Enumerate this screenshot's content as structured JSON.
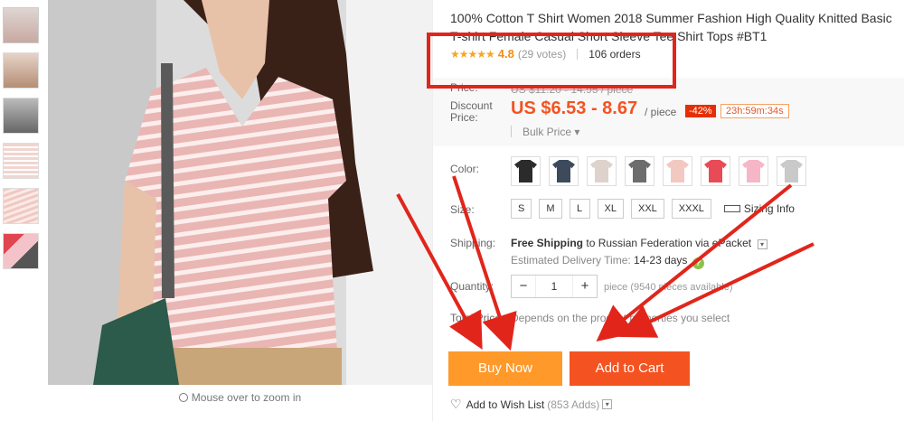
{
  "product": {
    "title_line1": "100% Cotton T Shirt Women 2018 Summer Fashion High Quality Knitted Basic",
    "title_line2": "T-shirt Female Casual Short Sleeve Tee Shirt Tops #BT1",
    "rating_value": "4.8",
    "votes": "(29 votes)",
    "orders": "106 orders",
    "stars": "★★★★★"
  },
  "gallery": {
    "zoom_hint": "Mouse over to zoom in"
  },
  "price": {
    "price_label": "Price:",
    "old_price": "US $11.20 - 14.95 / piece",
    "discount_label_1": "Discount",
    "discount_label_2": "Price:",
    "discount_price": "US $6.53 - 8.67",
    "per_piece": "/ piece",
    "discount_pct": "-42%",
    "timer": "23h:59m:34s",
    "bulk_price": "Bulk Price ▾"
  },
  "options": {
    "color_label": "Color:",
    "size_label": "Size:",
    "sizes": [
      "S",
      "M",
      "L",
      "XL",
      "XXL",
      "XXXL"
    ],
    "sizing_info": "Sizing Info",
    "colors": [
      "#2b2b2b",
      "#3c4a5c",
      "#ddd2cc",
      "#6d6d6d",
      "#f2c9c0",
      "#e84b55",
      "#f6b6c8",
      "#c9c9c9"
    ]
  },
  "shipping": {
    "label": "Shipping:",
    "free": "Free Shipping",
    "to": "to",
    "country": "Russian Federation via ePacket",
    "est_label": "Estimated Delivery Time:",
    "est_days": "14-23 days",
    "help": "?"
  },
  "quantity": {
    "label": "Quantity:",
    "value": "1",
    "minus": "−",
    "plus": "+",
    "note": "piece (9540 pieces available)"
  },
  "total": {
    "label": "Total Price:",
    "note": "Depends on the product properties you select"
  },
  "actions": {
    "buy_now": "Buy Now",
    "add_to_cart": "Add to Cart",
    "wish": "Add to Wish List",
    "wish_count": "(853 Adds)"
  }
}
